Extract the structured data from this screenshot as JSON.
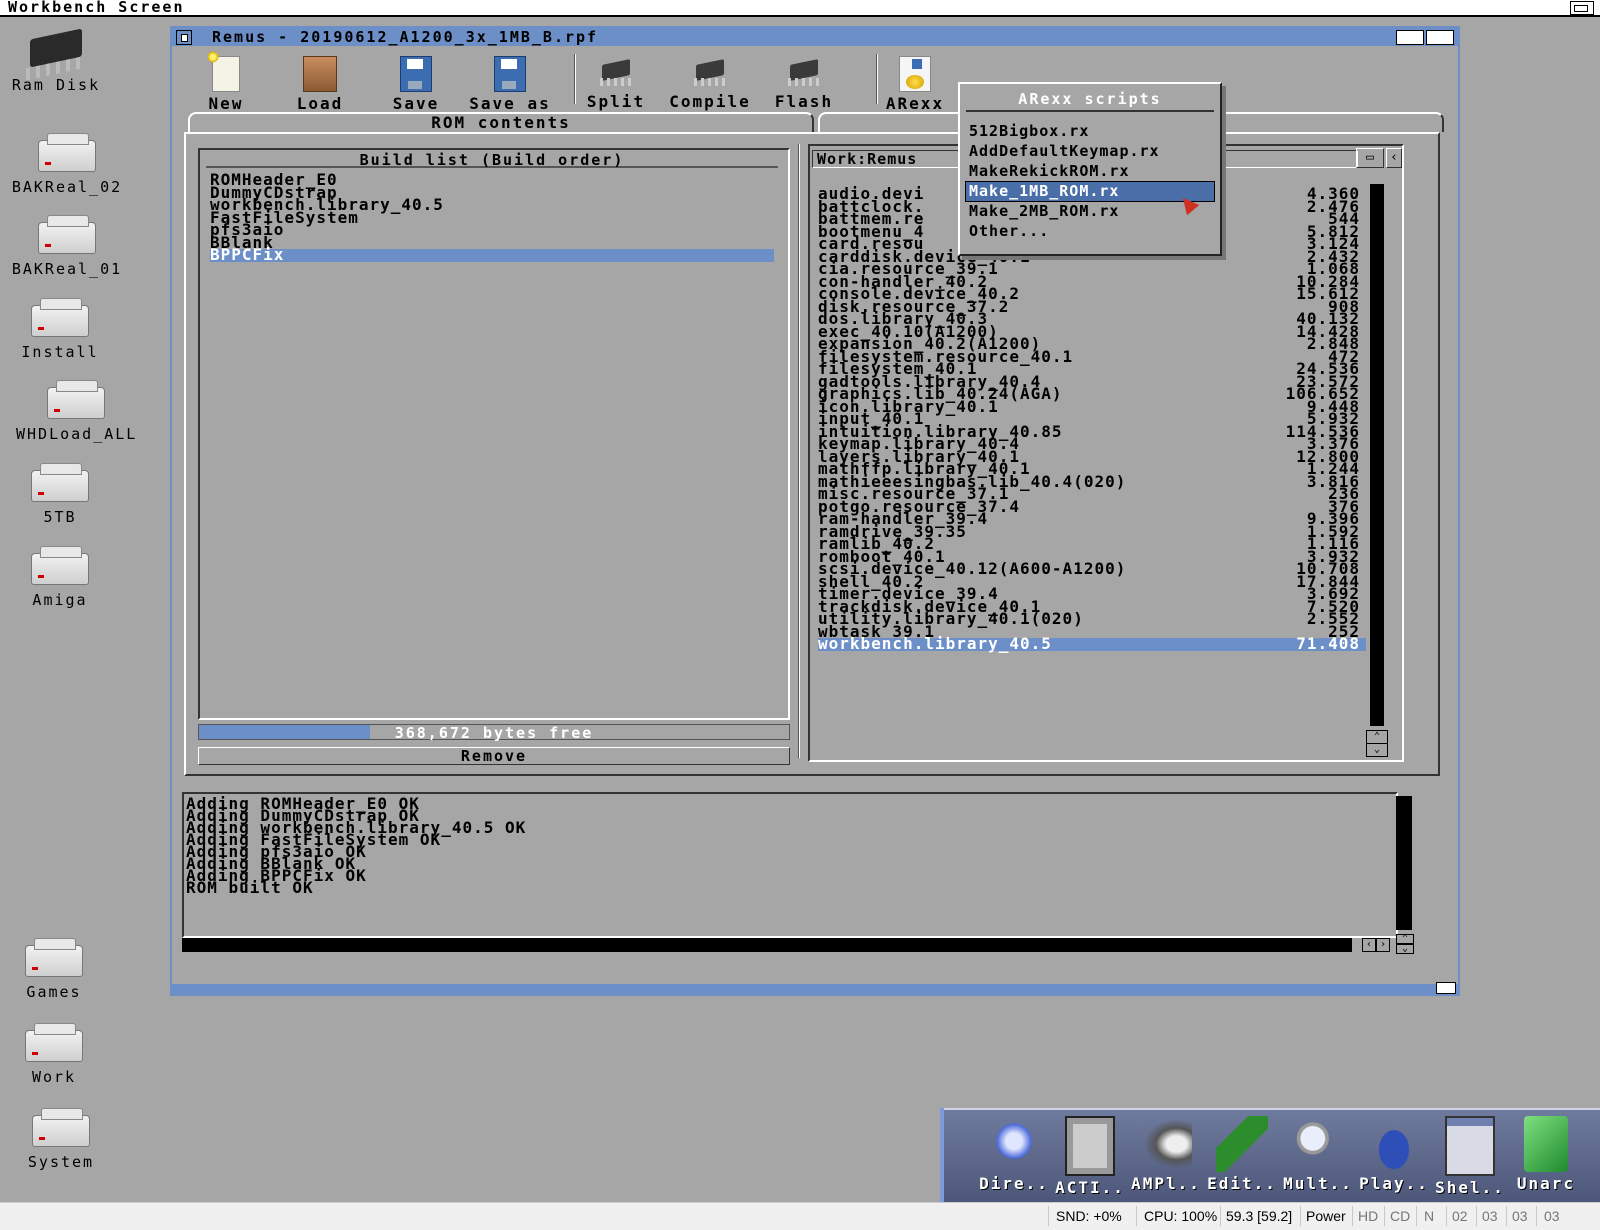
{
  "screen": {
    "title": "Workbench Screen"
  },
  "desktop_icons": [
    {
      "label": "Ram Disk",
      "icon": "chip-icon"
    },
    {
      "label": "BAKReal_02",
      "icon": "drive-icon"
    },
    {
      "label": "BAKReal_01",
      "icon": "drive-icon"
    },
    {
      "label": "Install",
      "icon": "drive-icon"
    },
    {
      "label": "WHDLoad_ALL",
      "icon": "drive-icon"
    },
    {
      "label": "5TB",
      "icon": "drive-icon"
    },
    {
      "label": "Amiga",
      "icon": "drive-icon"
    },
    {
      "label": "Games",
      "icon": "drive-icon"
    },
    {
      "label": "Work",
      "icon": "drive-icon"
    },
    {
      "label": "System",
      "icon": "drive-icon"
    }
  ],
  "window": {
    "title": "Remus - 20190612_A1200_3x_1MB_B.rpf",
    "toolbar": {
      "new": "New",
      "load": "Load",
      "save": "Save",
      "save_as": "Save as",
      "split": "Split",
      "compile": "Compile",
      "flash": "Flash",
      "arexx": "ARexx"
    },
    "tabs": {
      "rom_contents": "ROM contents",
      "second": ""
    },
    "build_list": {
      "title": "Build list (Build order)",
      "items": [
        "ROMHeader_E0",
        "DummyCDstrap",
        "workbench.library_40.5",
        "FastFileSystem",
        "pfs3aio",
        "BBlank",
        "BPPCFix"
      ],
      "selected": "BPPCFix"
    },
    "gauge": {
      "text": "368,672 bytes free",
      "fill_fraction": 0.29
    },
    "remove_button": "Remove",
    "path_field": "Work:Remus",
    "path_suffix": "/",
    "module_list": {
      "items": [
        {
          "name": "audio.devi",
          "size": "4.360"
        },
        {
          "name": "battclock.",
          "size": "2.476"
        },
        {
          "name": "battmem.re",
          "size": "544"
        },
        {
          "name": "bootmenu_4",
          "size": "5.812"
        },
        {
          "name": "card.resou",
          "size": "3.124"
        },
        {
          "name": "carddisk.device_40.1",
          "size": "2.432"
        },
        {
          "name": "cia.resource_39.1",
          "size": "1.068"
        },
        {
          "name": "con-handler_40.2",
          "size": "10.284"
        },
        {
          "name": "console.device_40.2",
          "size": "15.612"
        },
        {
          "name": "disk.resource_37.2",
          "size": "908"
        },
        {
          "name": "dos.library_40.3",
          "size": "40.132"
        },
        {
          "name": "exec_40.10(A1200)",
          "size": "14.428"
        },
        {
          "name": "expansion_40.2(A1200)",
          "size": "2.848"
        },
        {
          "name": "filesystem.resource_40.1",
          "size": "472"
        },
        {
          "name": "filesystem_40.1",
          "size": "24.536"
        },
        {
          "name": "gadtools.library_40.4",
          "size": "23.572"
        },
        {
          "name": "graphics.lib_40.24(AGA)",
          "size": "106.652"
        },
        {
          "name": "icon.library_40.1",
          "size": "9.448"
        },
        {
          "name": "input_40.1",
          "size": "5.932"
        },
        {
          "name": "intuition.library_40.85",
          "size": "114.536"
        },
        {
          "name": "keymap.library_40.4",
          "size": "3.376"
        },
        {
          "name": "layers.library_40.1",
          "size": "12.800"
        },
        {
          "name": "mathffp.library_40.1",
          "size": "1.244"
        },
        {
          "name": "mathieeesingbas.lib_40.4(020)",
          "size": "3.816"
        },
        {
          "name": "misc.resource_37.1",
          "size": "236"
        },
        {
          "name": "potgo.resource_37.4",
          "size": "376"
        },
        {
          "name": "ram-handler_39.4",
          "size": "9.396"
        },
        {
          "name": "ramdrive_39.35",
          "size": "1.592"
        },
        {
          "name": "ramlib_40.2",
          "size": "1.116"
        },
        {
          "name": "romboot_40.1",
          "size": "3.932"
        },
        {
          "name": "scsi.device_40.12(A600-A1200)",
          "size": "10.708"
        },
        {
          "name": "shell_40.2",
          "size": "17.844"
        },
        {
          "name": "timer.device_39.4",
          "size": "3.692"
        },
        {
          "name": "trackdisk.device_40.1",
          "size": "7.520"
        },
        {
          "name": "utility.library_40.1(020)",
          "size": "2.552"
        },
        {
          "name": "wbtask_39.1",
          "size": "252"
        },
        {
          "name": "workbench.library_40.5",
          "size": "71.408"
        }
      ],
      "selected": "workbench.library_40.5"
    },
    "console": {
      "lines": [
        "Adding ROMHeader_E0 OK",
        "Adding DummyCDstrap OK",
        "Adding workbench.library_40.5 OK",
        "Adding FastFileSystem OK",
        "Adding pfs3aio OK",
        "Adding BBlank OK",
        "Adding BPPCFix OK",
        "ROM built OK"
      ]
    }
  },
  "arexx_menu": {
    "title": "ARexx scripts",
    "items": [
      "512Bigbox.rx",
      "AddDefaultKeymap.rx",
      "MakeRekickROM.rx",
      "Make_1MB_ROM.rx",
      "Make_2MB_ROM.rx",
      "Other..."
    ],
    "selected": "Make_1MB_ROM.rx"
  },
  "dock": {
    "items": [
      {
        "label": "Dire..",
        "icon": "directory-opus-icon"
      },
      {
        "label": "ACTI..",
        "icon": "activity-icon"
      },
      {
        "label": "AMPl..",
        "icon": "speaker-icon"
      },
      {
        "label": "Edit..",
        "icon": "edit-pencil-icon"
      },
      {
        "label": "Mult..",
        "icon": "magnifier-icon"
      },
      {
        "label": "Play..",
        "icon": "play-disc-icon"
      },
      {
        "label": "Shel..",
        "icon": "shell-icon"
      },
      {
        "label": "Unarc",
        "icon": "cube-icon"
      }
    ]
  },
  "statusbar": {
    "snd": "SND: +0%",
    "cpu": "CPU: 100%",
    "fps": "59.3 [59.2]",
    "power": "Power",
    "hd": "HD",
    "cd": "CD",
    "n": "N",
    "d0": "02",
    "d1": "03",
    "d2": "03",
    "d3": "03"
  },
  "colors": {
    "workbench_grey": "#a6a6a6",
    "accent_blue": "#6c8fc7"
  }
}
